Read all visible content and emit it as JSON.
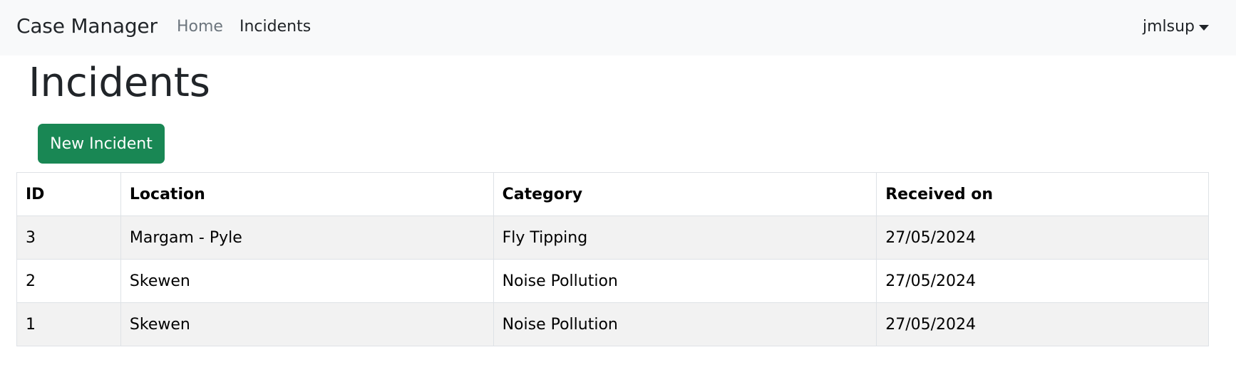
{
  "navbar": {
    "brand": "Case Manager",
    "links": [
      {
        "label": "Home"
      },
      {
        "label": "Incidents"
      }
    ],
    "user": "jmlsup"
  },
  "page": {
    "title": "Incidents",
    "new_button_label": "New Incident"
  },
  "table": {
    "headers": [
      "ID",
      "Location",
      "Category",
      "Received on"
    ],
    "rows": [
      [
        "3",
        "Margam - Pyle",
        "Fly Tipping",
        "27/05/2024"
      ],
      [
        "2",
        "Skewen",
        "Noise Pollution",
        "27/05/2024"
      ],
      [
        "1",
        "Skewen",
        "Noise Pollution",
        "27/05/2024"
      ]
    ]
  },
  "colors": {
    "navbar_bg": "#f8f9fa",
    "primary_button": "#198754",
    "stripe": "#f2f2f2"
  }
}
